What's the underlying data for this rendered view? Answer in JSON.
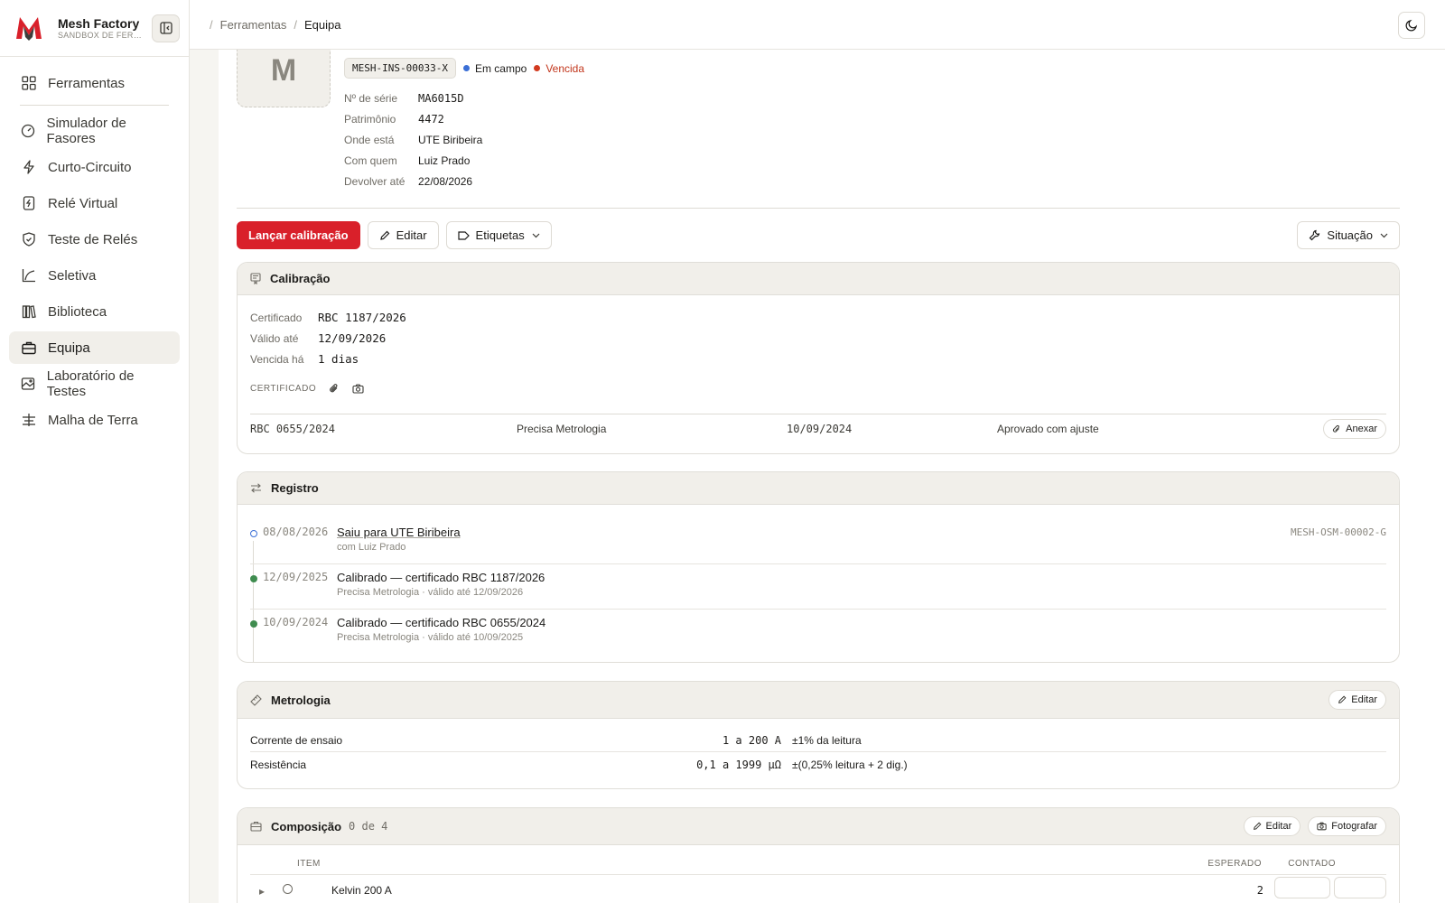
{
  "brand": {
    "name": "Mesh Factory",
    "subtitle": "SANDBOX DE FERRAMENTAS"
  },
  "nav": [
    {
      "label": "Ferramentas",
      "icon": "grid-icon"
    },
    {
      "label": "Simulador de Fasores",
      "icon": "gauge-icon"
    },
    {
      "label": "Curto-Circuito",
      "icon": "bolt-icon"
    },
    {
      "label": "Relé Virtual",
      "icon": "relay-icon"
    },
    {
      "label": "Teste de Relés",
      "icon": "shield-icon"
    },
    {
      "label": "Seletiva",
      "icon": "curve-chart-icon"
    },
    {
      "label": "Biblioteca",
      "icon": "library-icon"
    },
    {
      "label": "Equipa",
      "icon": "briefcase-icon",
      "active": true
    },
    {
      "label": "Laboratório de Testes",
      "icon": "image-lab-icon"
    },
    {
      "label": "Malha de Terra",
      "icon": "ground-icon"
    }
  ],
  "breadcrumb": {
    "sep": "/",
    "parent": "Ferramentas",
    "current": "Equipa"
  },
  "asset": {
    "photo_letter": "M",
    "code": "MESH-INS-00033-X",
    "status_field": "Em campo",
    "status_cal": "Vencida",
    "colors": {
      "field": "#3b6fd6",
      "expired": "#d23a1f",
      "primary": "#d9202a",
      "ok": "#3f8c4f"
    },
    "fields": [
      {
        "label": "Nº de série",
        "value": "MA6015D",
        "mono": true
      },
      {
        "label": "Patrimônio",
        "value": "4472",
        "mono": true
      },
      {
        "label": "Onde está",
        "value": "UTE Biribeira"
      },
      {
        "label": "Com quem",
        "value": "Luiz Prado"
      },
      {
        "label": "Devolver até",
        "value": "22/08/2026"
      }
    ]
  },
  "actions": {
    "launch": "Lançar calibração",
    "edit": "Editar",
    "tags": "Etiquetas",
    "situation": "Situação"
  },
  "calibration": {
    "title": "Calibração",
    "fields": [
      {
        "label": "Certificado",
        "value": "RBC 1187/2026"
      },
      {
        "label": "Válido até",
        "value": "12/09/2026"
      },
      {
        "label": "Vencida há",
        "value": "1 dias"
      }
    ],
    "cert_label": "CERTIFICADO",
    "history": {
      "cert": "RBC 0655/2024",
      "lab": "Precisa Metrologia",
      "date": "10/09/2024",
      "result": "Aprovado com ajuste",
      "attach": "Anexar"
    }
  },
  "registry": {
    "title": "Registro",
    "items": [
      {
        "date": "08/08/2026",
        "title": "Saiu para UTE Biribeira",
        "sub": "com Luiz Prado",
        "ref": "MESH-OSM-00002-G",
        "kind": "open"
      },
      {
        "date": "12/09/2025",
        "title": "Calibrado — certificado RBC 1187/2026",
        "sub": "Precisa Metrologia · válido até 12/09/2026",
        "ref": "",
        "kind": "ok"
      },
      {
        "date": "10/09/2024",
        "title": "Calibrado — certificado RBC 0655/2024",
        "sub": "Precisa Metrologia · válido até 10/09/2025",
        "ref": "",
        "kind": "ok"
      }
    ]
  },
  "metrology": {
    "title": "Metrologia",
    "edit": "Editar",
    "rows": [
      {
        "name": "Corrente de ensaio",
        "range": "1 a 200 A",
        "accuracy": "±1% da leitura"
      },
      {
        "name": "Resistência",
        "range": "0,1 a 1999 µΩ",
        "accuracy": "±(0,25% leitura + 2 dig.)"
      }
    ]
  },
  "composition": {
    "title": "Composição",
    "count": "0 de 4",
    "edit": "Editar",
    "photo": "Fotografar",
    "col_item": "ITEM",
    "col_expected": "ESPERADO",
    "col_counted": "CONTADO",
    "first_item": "Kelvin 200 A",
    "first_expected": "2"
  }
}
